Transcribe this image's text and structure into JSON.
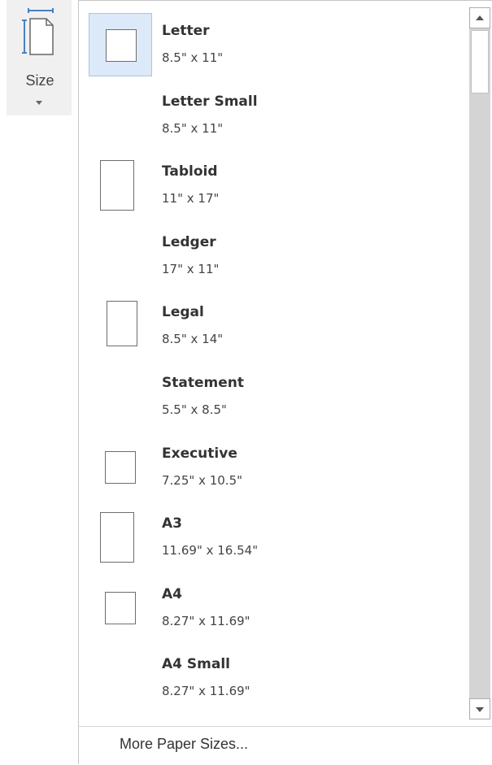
{
  "ribbon": {
    "size_button": {
      "label": "Size",
      "icon": "page-size-icon"
    }
  },
  "menu": {
    "selected_index": 0,
    "items": [
      {
        "name": "Letter",
        "dims": "8.5\" x 11\"",
        "thumb": "portrait"
      },
      {
        "name": "Letter Small",
        "dims": "8.5\" x 11\"",
        "thumb": "none"
      },
      {
        "name": "Tabloid",
        "dims": "11\" x 17\"",
        "thumb": "tall"
      },
      {
        "name": "Ledger",
        "dims": "17\" x 11\"",
        "thumb": "none"
      },
      {
        "name": "Legal",
        "dims": "8.5\" x 14\"",
        "thumb": "legal"
      },
      {
        "name": "Statement",
        "dims": "5.5\" x 8.5\"",
        "thumb": "none"
      },
      {
        "name": "Executive",
        "dims": "7.25\" x 10.5\"",
        "thumb": "portrait"
      },
      {
        "name": "A3",
        "dims": "11.69\" x 16.54\"",
        "thumb": "tall"
      },
      {
        "name": "A4",
        "dims": "8.27\" x 11.69\"",
        "thumb": "portrait"
      },
      {
        "name": "A4 Small",
        "dims": "8.27\" x 11.69\"",
        "thumb": "none"
      }
    ],
    "more_label": "More Paper Sizes..."
  },
  "colors": {
    "selected_bg": "#dce9f8",
    "selected_border": "#a9c4e6",
    "icon_blue": "#4a7fc1"
  }
}
